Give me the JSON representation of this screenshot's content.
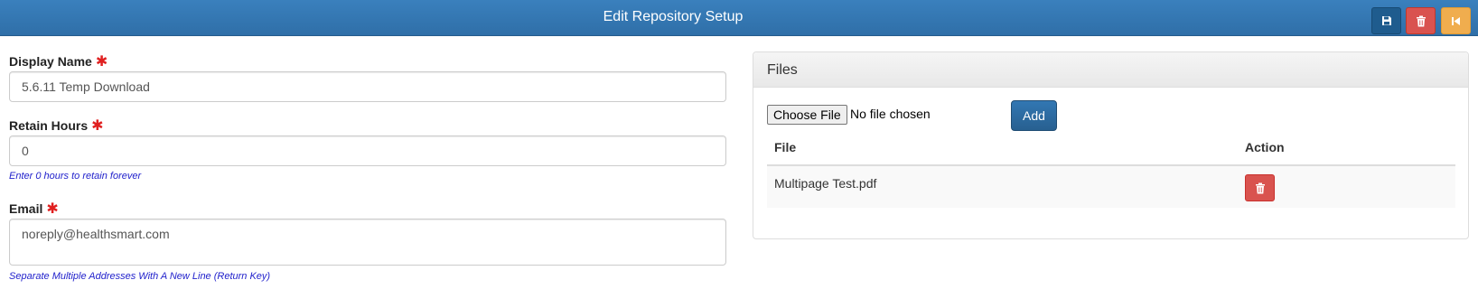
{
  "header": {
    "title": "Edit Repository Setup",
    "accent": "#337ab7"
  },
  "toolbar": {
    "save_icon": "floppy-disk-icon",
    "delete_icon": "trash-icon",
    "back_icon": "step-backward-icon",
    "save_color": "#1f5c8e",
    "delete_color": "#d9534f",
    "back_color": "#f0ad4e"
  },
  "form": {
    "display_name": {
      "label": "Display Name",
      "required_mark": "✱",
      "value": "5.6.11 Temp Download"
    },
    "retain_hours": {
      "label": "Retain Hours",
      "required_mark": "✱",
      "value": "0",
      "help": "Enter 0 hours to retain forever"
    },
    "email": {
      "label": "Email",
      "required_mark": "✱",
      "value": "noreply@healthsmart.com",
      "help": "Separate Multiple Addresses With A New Line (Return Key)"
    }
  },
  "files_panel": {
    "title": "Files",
    "choose_file_label": "Choose File",
    "no_file_text": "No file chosen",
    "add_label": "Add",
    "columns": [
      "File",
      "Action"
    ],
    "rows": [
      {
        "file": "Multipage Test.pdf",
        "action_icon": "trash-icon"
      }
    ]
  }
}
